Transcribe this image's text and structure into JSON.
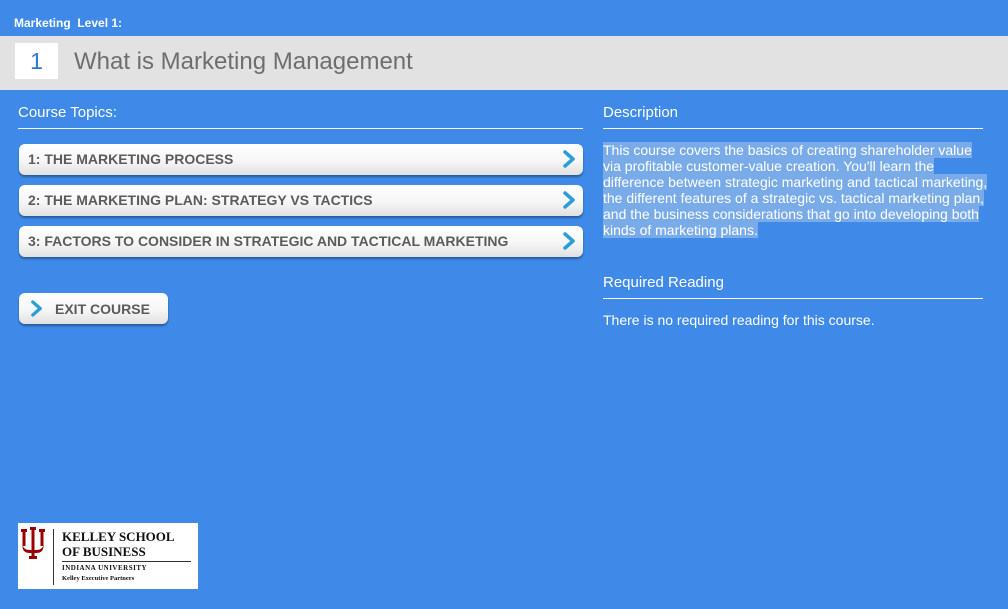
{
  "header": {
    "breadcrumb": "Marketing  Level 1:",
    "level_number": "1",
    "title": "What is Marketing Management"
  },
  "topics": {
    "heading": "Course Topics:",
    "items": [
      {
        "label": "1: THE MARKETING PROCESS"
      },
      {
        "label": "2: THE MARKETING PLAN: STRATEGY VS TACTICS"
      },
      {
        "label": "3: FACTORS TO CONSIDER IN STRATEGIC AND TACTICAL MARKETING"
      }
    ],
    "exit_label": "EXIT COURSE"
  },
  "description": {
    "heading": "Description",
    "text": "This course covers the basics of creating shareholder value via profitable customer-value creation. You'll learn the difference between strategic marketing and tactical marketing, the different features of a strategic vs. tactical marketing plan, and the business considerations that go into developing both kinds of marketing plans."
  },
  "reading": {
    "heading": "Required Reading",
    "text": "There is no required reading for this course."
  },
  "logo": {
    "line1": "KELLEY SCHOOL",
    "line2": "OF BUSINESS",
    "line3": "INDIANA UNIVERSITY",
    "line4": "Kelley Executive Partners"
  },
  "icons": {
    "chevron": "chevron-right-icon",
    "logo_mark": "iu-trident-icon"
  },
  "colors": {
    "background": "#3f8ae8",
    "title_bar": "#e2e2e2",
    "accent": "#2a9fd6",
    "logo_red": "#990000"
  }
}
